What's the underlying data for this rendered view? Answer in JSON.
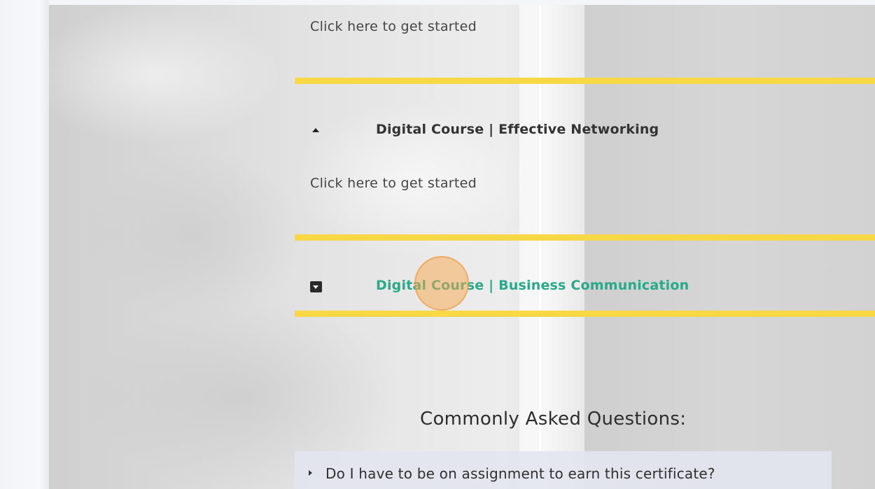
{
  "accordion": {
    "items": [
      {
        "title": "",
        "body": "Click here to get started",
        "state": "expanded"
      },
      {
        "title": "Digital Course | Effective Networking",
        "body": "Click here to get started",
        "state": "expanded",
        "icon": "caret-up-icon"
      },
      {
        "title": "Digital Course | Business Communication",
        "body": "",
        "state": "collapsed",
        "icon": "caret-down-box-icon",
        "color": "#2aa98a"
      }
    ]
  },
  "faq": {
    "heading": "Commonly Asked Questions:",
    "items": [
      {
        "question": "Do I have to be on assignment to earn this certificate?",
        "icon": "caret-right-icon"
      }
    ]
  },
  "colors": {
    "accent_yellow": "#f8d845",
    "active_link": "#2aa98a",
    "click_indicator": "#f7a84a"
  }
}
